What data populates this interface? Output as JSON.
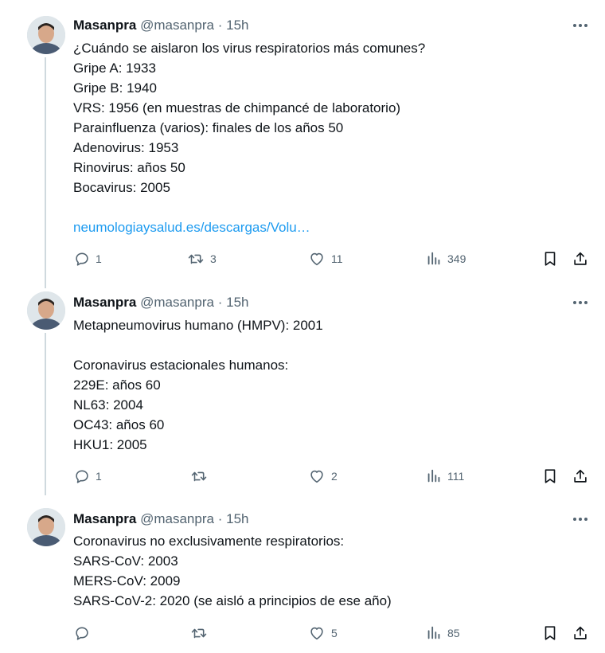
{
  "tweets": [
    {
      "name": "Masanpra",
      "handle": "@masanpra",
      "dot": "·",
      "time": "15h",
      "lines": [
        "¿Cuándo se aislaron los virus respiratorios más comunes?",
        "Gripe A: 1933",
        "Gripe B: 1940",
        "VRS: 1956 (en muestras de chimpancé de laboratorio)",
        "Parainfluenza (varios): finales de los años 50",
        "Adenovirus: 1953",
        "Rinovirus: años 50",
        "Bocavirus: 2005",
        "",
        "neumologiaysalud.es/descargas/Volu…"
      ],
      "replies": "1",
      "retweets": "3",
      "likes": "11",
      "views": "349"
    },
    {
      "name": "Masanpra",
      "handle": "@masanpra",
      "dot": "·",
      "time": "15h",
      "lines": [
        "Metapneumovirus humano (HMPV): 2001",
        "",
        "Coronavirus estacionales humanos:",
        "229E: años 60",
        "NL63: 2004",
        "OC43: años 60",
        "HKU1: 2005"
      ],
      "replies": "1",
      "retweets": "",
      "likes": "2",
      "views": "111"
    },
    {
      "name": "Masanpra",
      "handle": "@masanpra",
      "dot": "·",
      "time": "15h",
      "lines": [
        "Coronavirus no exclusivamente respiratorios:",
        "SARS-CoV: 2003",
        "MERS-CoV: 2009",
        "SARS-CoV-2: 2020 (se aisló a principios de ese año)"
      ],
      "replies": "",
      "retweets": "",
      "likes": "5",
      "views": "85"
    }
  ],
  "colors": {
    "text": "#0f1419",
    "muted": "#536471",
    "link": "#1d9bf0",
    "thread": "#cfd9de"
  },
  "icons": [
    "reply-icon",
    "retweet-icon",
    "like-icon",
    "views-icon",
    "bookmark-icon",
    "share-icon",
    "more-icon"
  ]
}
